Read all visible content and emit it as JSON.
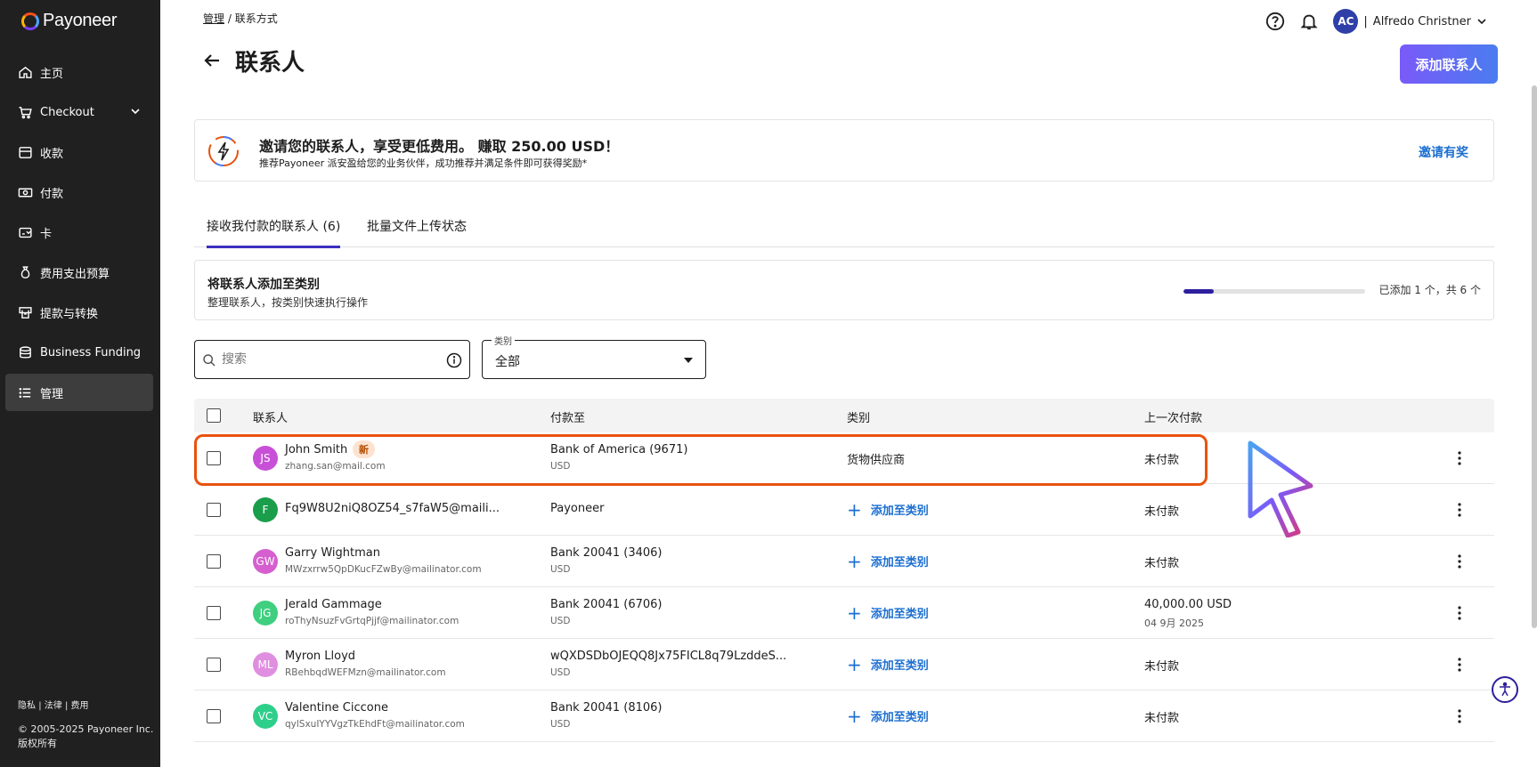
{
  "brand": {
    "name": "Payoneer"
  },
  "sidebar": {
    "items": [
      {
        "label": "主页",
        "icon": "home-icon"
      },
      {
        "label": "Checkout",
        "icon": "cart-icon"
      },
      {
        "label": "收款",
        "icon": "inbox-icon"
      },
      {
        "label": "付款",
        "icon": "cash-icon"
      },
      {
        "label": "卡",
        "icon": "card-icon"
      },
      {
        "label": "费用支出预算",
        "icon": "money-bag-icon"
      },
      {
        "label": "提款与转换",
        "icon": "withdraw-icon"
      },
      {
        "label": "Business Funding",
        "icon": "coins-icon"
      },
      {
        "label": "管理",
        "icon": "list-icon"
      }
    ],
    "active_index": 8,
    "footer": {
      "privacy": "隐私",
      "legal": "法律",
      "fees": "费用",
      "sep": "|",
      "copyright": "© 2005-2025 Payoneer Inc.",
      "rights": "版权所有"
    }
  },
  "breadcrumb": {
    "parent": "管理",
    "sep": "/",
    "current": "联系方式"
  },
  "topbar": {
    "avatar_initials": "AC",
    "user_name": "Alfredo Christner",
    "sep": "|"
  },
  "page": {
    "title": "联系人",
    "add_button": "添加联系人"
  },
  "banner": {
    "title": "邀请您的联系人，享受更低费用。 赚取 250.00 USD！",
    "subtitle": "推荐Payoneer 派安盈给您的业务伙伴，成功推荐并满足条件即可获得奖励*",
    "link": "邀请有奖"
  },
  "tabs": [
    {
      "label": "接收我付款的联系人 (6)"
    },
    {
      "label": "批量文件上传状态"
    }
  ],
  "category_card": {
    "title": "将联系人添加至类别",
    "subtitle": "整理联系人，按类别快速执行操作",
    "progress_text": "已添加 1 个，共 6 个",
    "progress_fraction": 0.1667
  },
  "filters": {
    "search_placeholder": "搜索",
    "category_label": "类别",
    "category_value": "全部"
  },
  "table": {
    "headers": {
      "contact": "联系人",
      "pay_to": "付款至",
      "category": "类别",
      "last_payment": "上一次付款"
    },
    "rows": [
      {
        "initials": "JS",
        "color": "#c84fd8",
        "name": "John Smith",
        "badge": "新",
        "email": "zhang.san@mail.com",
        "pay_to": "Bank of America (9671)",
        "currency": "USD",
        "category": "货物供应商",
        "add_category": "",
        "last": "未付款",
        "last_date": ""
      },
      {
        "initials": "F",
        "color": "#1a9e4b",
        "name": "Fq9W8U2niQ8OZ54_s7faW5@maili...",
        "badge": "",
        "email": "",
        "pay_to": "Payoneer",
        "currency": "",
        "category": "",
        "add_category": "添加至类别",
        "last": "未付款",
        "last_date": ""
      },
      {
        "initials": "GW",
        "color": "#d65fd0",
        "name": "Garry Wightman",
        "badge": "",
        "email": "MWzxrrw5QpDKucFZwBy@mailinator.com",
        "pay_to": "Bank 20041 (3406)",
        "currency": "USD",
        "category": "",
        "add_category": "添加至类别",
        "last": "未付款",
        "last_date": ""
      },
      {
        "initials": "JG",
        "color": "#3fcf7f",
        "name": "Jerald Gammage",
        "badge": "",
        "email": "roThyNsuzFvGrtqPjjf@mailinator.com",
        "pay_to": "Bank 20041 (6706)",
        "currency": "USD",
        "category": "",
        "add_category": "添加至类别",
        "last": "40,000.00 USD",
        "last_date": "04 9月 2025"
      },
      {
        "initials": "ML",
        "color": "#e08fe0",
        "name": "Myron Lloyd",
        "badge": "",
        "email": "RBehbqdWEFMzn@mailinator.com",
        "pay_to": "wQXDSDbOJEQQ8Jx75FICL8q79LzddeS...",
        "currency": "USD",
        "category": "",
        "add_category": "添加至类别",
        "last": "未付款",
        "last_date": ""
      },
      {
        "initials": "VC",
        "color": "#2ecf8a",
        "name": "Valentine Ciccone",
        "badge": "",
        "email": "qylSxuIYYVgzTkEhdFt@mailinator.com",
        "pay_to": "Bank 20041 (8106)",
        "currency": "USD",
        "category": "",
        "add_category": "添加至类别",
        "last": "未付款",
        "last_date": ""
      }
    ]
  },
  "colors": {
    "accent": "#3c2fbf",
    "link": "#1c6fd1",
    "highlight": "#e8530e",
    "sidebar_bg": "#202020"
  }
}
